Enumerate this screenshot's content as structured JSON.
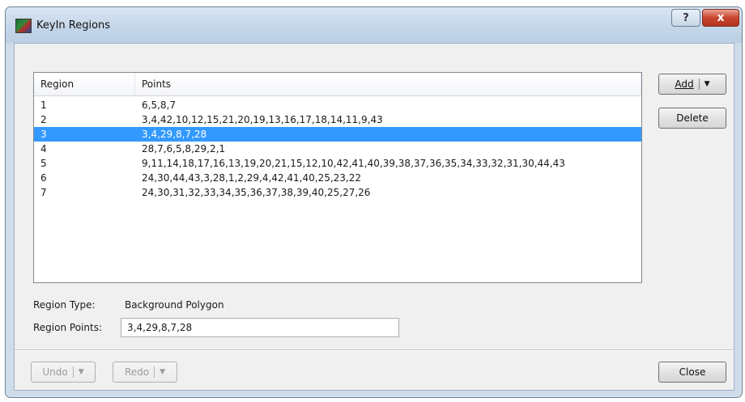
{
  "window": {
    "title": "KeyIn Regions",
    "help_label": "?",
    "close_glyph": "x"
  },
  "listview": {
    "headers": {
      "region": "Region",
      "points": "Points"
    },
    "rows": [
      {
        "region": "1",
        "points": "6,5,8,7"
      },
      {
        "region": "2",
        "points": "3,4,42,10,12,15,21,20,19,13,16,17,18,14,11,9,43"
      },
      {
        "region": "3",
        "points": "3,4,29,8,7,28"
      },
      {
        "region": "4",
        "points": "28,7,6,5,8,29,2,1"
      },
      {
        "region": "5",
        "points": "9,11,14,18,17,16,13,19,20,21,15,12,10,42,41,40,39,38,37,36,35,34,33,32,31,30,44,43"
      },
      {
        "region": "6",
        "points": "24,30,44,43,3,28,1,2,29,4,42,41,40,25,23,22"
      },
      {
        "region": "7",
        "points": "24,30,31,32,33,34,35,36,37,38,39,40,25,27,26"
      }
    ],
    "selected_row": "3"
  },
  "details": {
    "region_type_label": "Region Type:",
    "region_type_value": "Background Polygon",
    "region_points_label": "Region Points:",
    "region_points_value": "3,4,29,8,7,28"
  },
  "buttons": {
    "add": "Add",
    "delete": "Delete",
    "undo": "Undo",
    "redo": "Redo",
    "close": "Close"
  },
  "icons": {
    "add_dropdown": "▼",
    "undo_dropdown": "▼",
    "redo_dropdown": "▼"
  }
}
